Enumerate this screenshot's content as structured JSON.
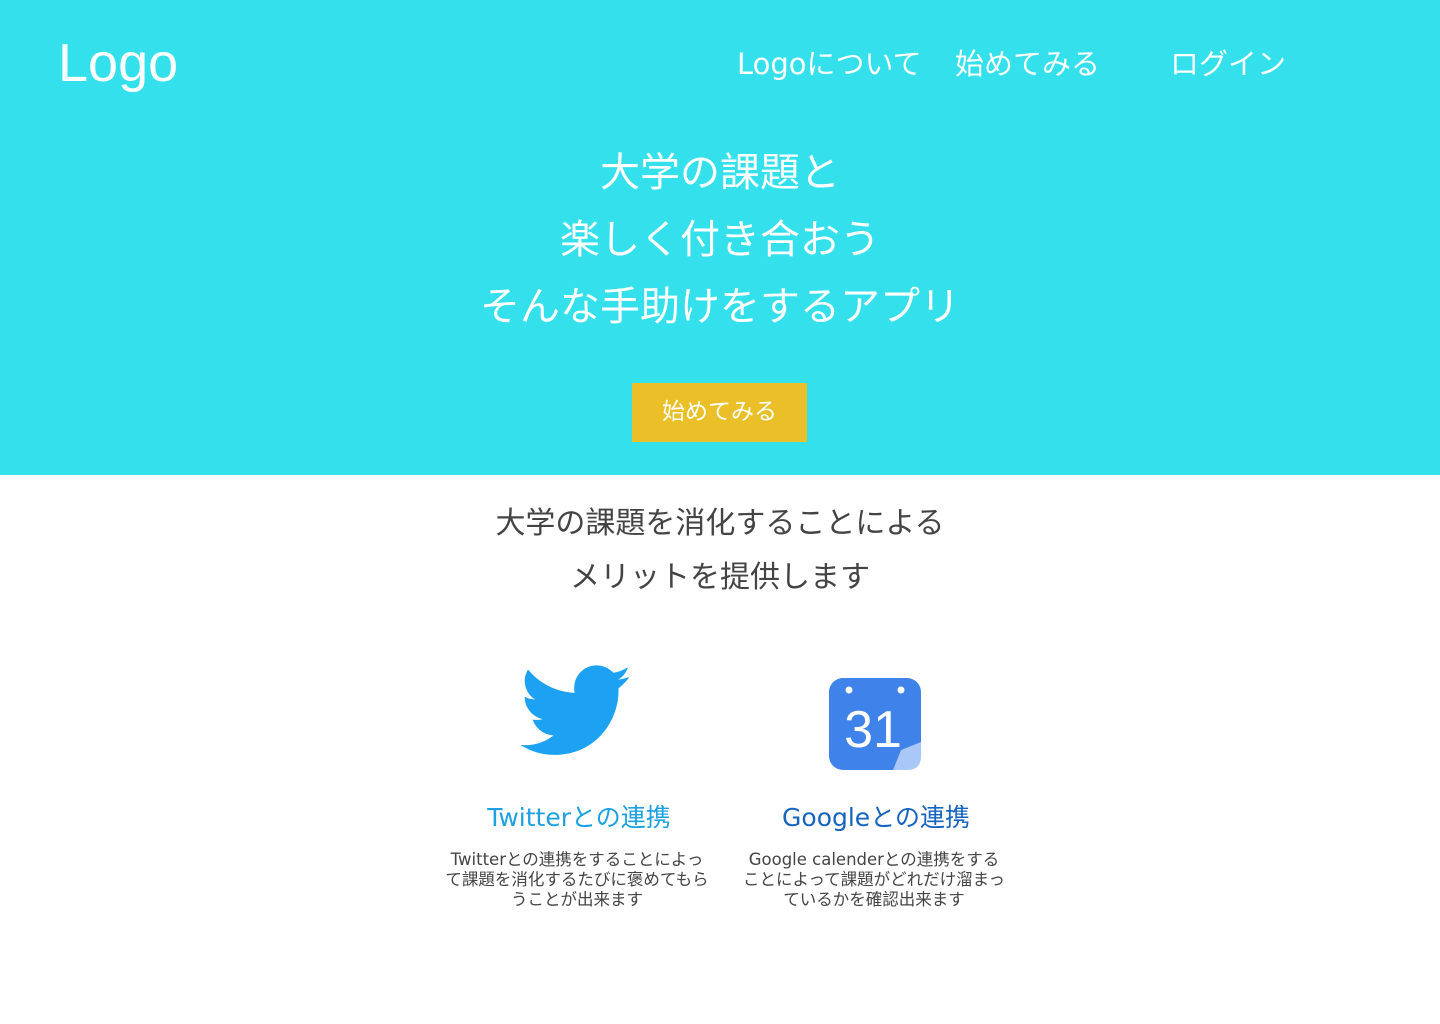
{
  "header": {
    "logo": "Logo",
    "nav": {
      "about": "Logoについて",
      "start": "始めてみる",
      "login": "ログイン"
    }
  },
  "hero": {
    "headline": [
      "大学の課題と",
      "楽しく付き合おう",
      "そんな手助けをするアプリ"
    ],
    "cta_label": "始めてみる"
  },
  "merit": {
    "lines": [
      "大学の課題を消化することによる",
      "メリットを提供します"
    ]
  },
  "features": [
    {
      "icon": "twitter-bird-icon",
      "title": "Twitterとの連携",
      "description": "Twitterとの連携をすることによって課題を消化するたびに褒めてもらうことが出来ます"
    },
    {
      "icon": "google-calendar-icon",
      "icon_text": "31",
      "title": "Googleとの連携",
      "description": "Google calenderとの連携をすることによって課題がどれだけ溜まっているかを確認出来ます"
    }
  ],
  "colors": {
    "hero_background": "#33e0eb",
    "cta_background": "#ebbf28",
    "twitter_blue": "#1da1e2",
    "google_blue": "#1565c0"
  }
}
